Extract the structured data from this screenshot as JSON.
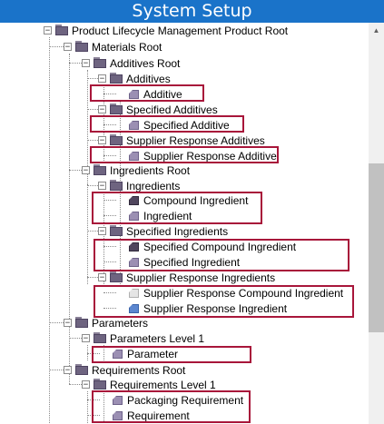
{
  "title": "System Setup",
  "tree": {
    "rows": [
      {
        "label": "Product Lifecycle Management Product Root",
        "kind": "folder",
        "expander": "−"
      },
      {
        "label": "Materials Root",
        "kind": "folder",
        "expander": "−"
      },
      {
        "label": "Additives Root",
        "kind": "folder",
        "expander": "−"
      },
      {
        "label": "Additives",
        "kind": "folder",
        "expander": "−"
      },
      {
        "label": "Additive",
        "kind": "item"
      },
      {
        "label": "Specified Additives",
        "kind": "folder",
        "expander": "−"
      },
      {
        "label": "Specified Additive",
        "kind": "item"
      },
      {
        "label": "Supplier Response Additives",
        "kind": "folder",
        "expander": "−"
      },
      {
        "label": "Supplier Response Additive",
        "kind": "item"
      },
      {
        "label": "Ingredients Root",
        "kind": "folder",
        "expander": "−"
      },
      {
        "label": "Ingredients",
        "kind": "folder",
        "expander": "−"
      },
      {
        "label": "Compound Ingredient",
        "kind": "item-dark"
      },
      {
        "label": "Ingredient",
        "kind": "item"
      },
      {
        "label": "Specified Ingredients",
        "kind": "folder",
        "expander": "−"
      },
      {
        "label": "Specified Compound Ingredient",
        "kind": "item-dark"
      },
      {
        "label": "Specified Ingredient",
        "kind": "item"
      },
      {
        "label": "Supplier Response Ingredients",
        "kind": "folder",
        "expander": "−"
      },
      {
        "label": "Supplier Response Compound Ingredient",
        "kind": "item-light"
      },
      {
        "label": "Supplier Response Ingredient",
        "kind": "item-blue"
      },
      {
        "label": "Parameters",
        "kind": "folder",
        "expander": "−"
      },
      {
        "label": "Parameters Level 1",
        "kind": "folder",
        "expander": "−"
      },
      {
        "label": "Parameter",
        "kind": "item"
      },
      {
        "label": "Requirements Root",
        "kind": "folder",
        "expander": "−"
      },
      {
        "label": "Requirements Level 1",
        "kind": "folder",
        "expander": "−"
      },
      {
        "label": "Packaging Requirement",
        "kind": "item"
      },
      {
        "label": "Requirement",
        "kind": "item"
      }
    ]
  },
  "colors": {
    "titlebar": "#1a73c9",
    "highlight": "#a8163a"
  }
}
